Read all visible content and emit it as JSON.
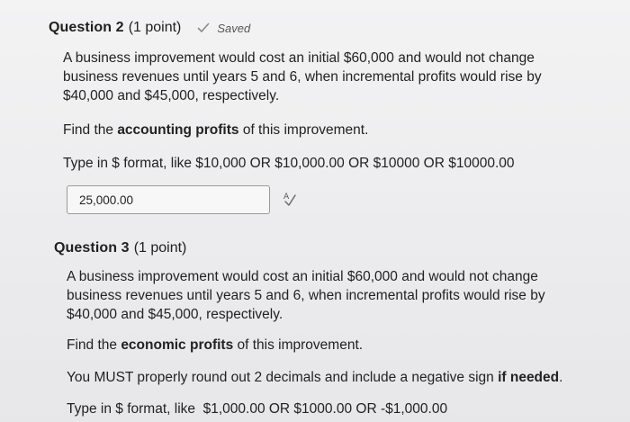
{
  "question2": {
    "title": "Question 2",
    "points": "(1 point)",
    "saved_label": "Saved",
    "body_lines": [
      "A business improvement would cost an initial $60,000 and would not change",
      "business revenues until years 5 and 6, when incremental profits would rise by",
      "$40,000 and $45,000, respectively."
    ],
    "find_prefix": "Find the ",
    "find_bold": "accounting profits",
    "find_suffix": " of this improvement.",
    "format_hint": "Type in $ format, like $10,000 OR $10,000.00 OR $10000 OR $10000.00",
    "answer_value": "25,000.00",
    "spellcheck_icon": "spellcheck-icon"
  },
  "question3": {
    "title": "Question 3",
    "points": "(1 point)",
    "body_lines": [
      "A business improvement would cost an initial $60,000 and would not change",
      "business revenues until years 5 and 6, when incremental profits would rise by",
      "$40,000 and $45,000, respectively."
    ],
    "find_prefix": "Find the ",
    "find_bold": "economic profits",
    "find_suffix": " of this improvement.",
    "instruction_prefix": "You MUST properly round out 2 decimals and include a negative sign ",
    "instruction_bold": "if needed",
    "instruction_suffix": ".",
    "format_hint": "Type in $ format, like  $1,000.00 OR $1000.00 OR -$1,000.00"
  },
  "colors": {
    "background": "#efeff0",
    "text": "#1f1f1f",
    "saved_text": "#555555",
    "input_border": "#9a9a9a"
  }
}
